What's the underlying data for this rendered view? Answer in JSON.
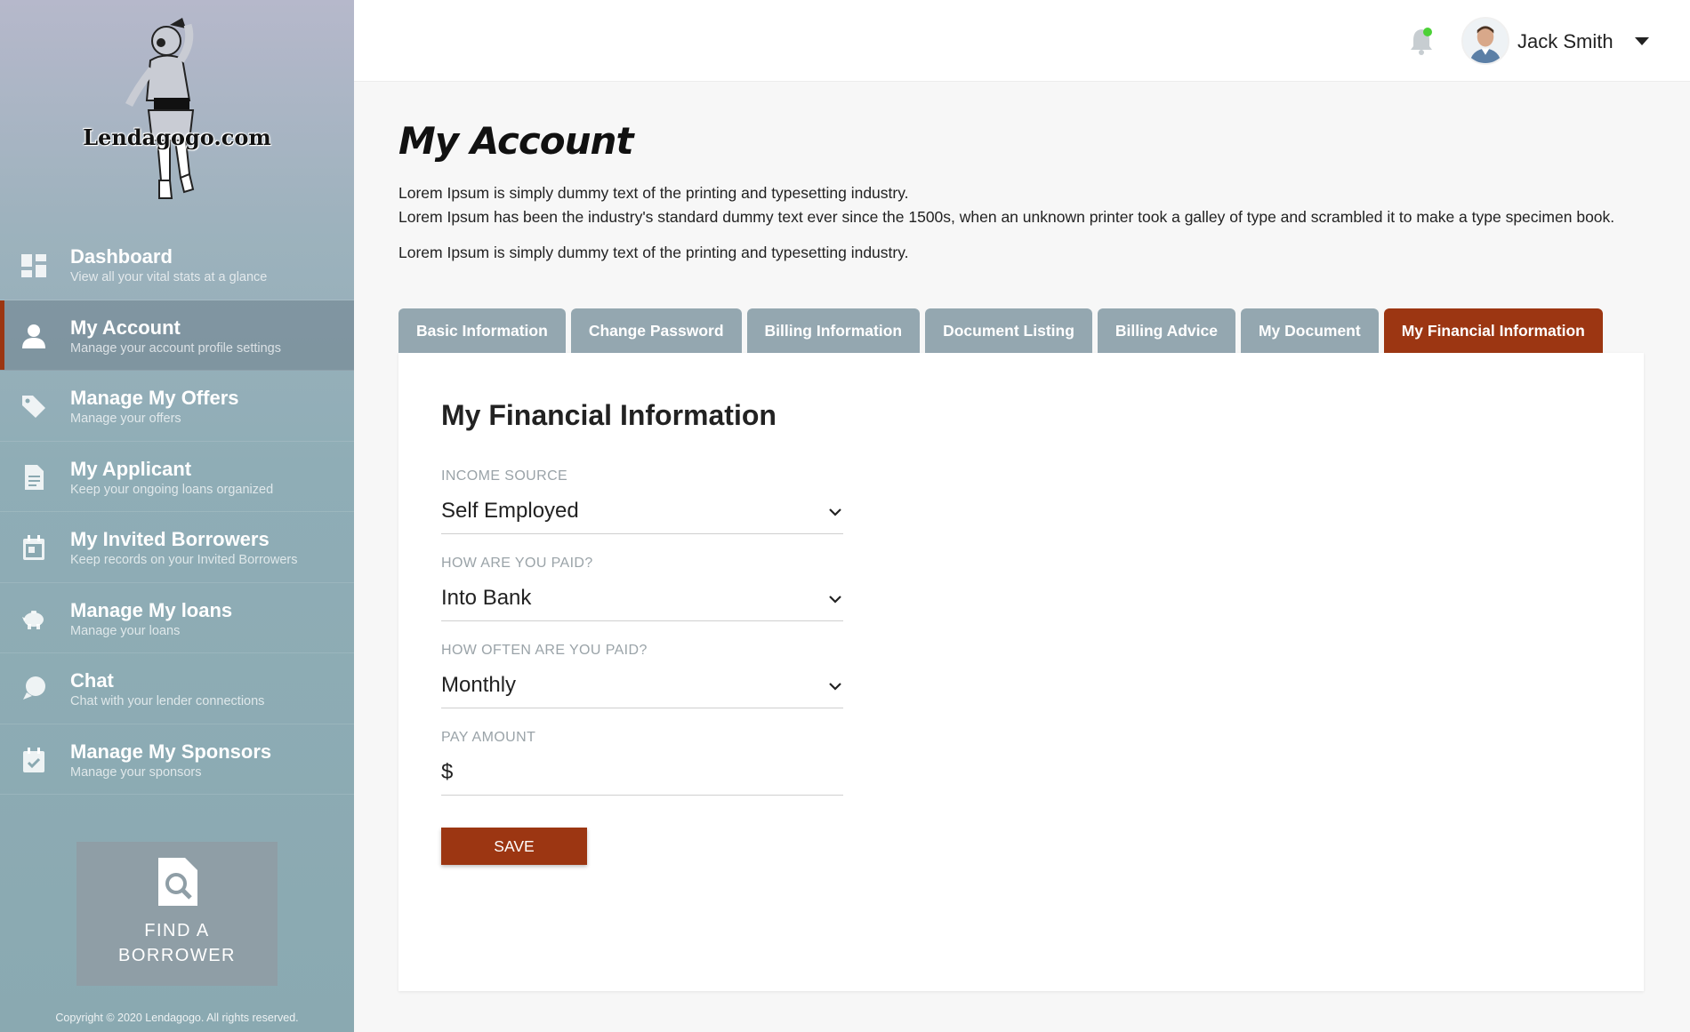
{
  "brand": {
    "logo_text": "Lendagogo.com"
  },
  "sidebar": {
    "items": [
      {
        "title": "Dashboard",
        "subtitle": "View all your vital stats at a glance",
        "icon": "dashboard-icon"
      },
      {
        "title": "My Account",
        "subtitle": "Manage your account profile settings",
        "icon": "user-icon",
        "active": true
      },
      {
        "title": "Manage My Offers",
        "subtitle": "Manage your offers",
        "icon": "tag-icon"
      },
      {
        "title": "My Applicant",
        "subtitle": "Keep your ongoing loans organized",
        "icon": "document-icon"
      },
      {
        "title": "My Invited Borrowers",
        "subtitle": "Keep records on your Invited Borrowers",
        "icon": "calendar-icon"
      },
      {
        "title": "Manage My loans",
        "subtitle": "Manage your loans",
        "icon": "piggy-bank-icon"
      },
      {
        "title": "Chat",
        "subtitle": "Chat with your lender connections",
        "icon": "chat-icon"
      },
      {
        "title": "Manage My Sponsors",
        "subtitle": "Manage  your sponsors",
        "icon": "calendar-check-icon"
      }
    ],
    "find_borrower_label": "FIND A\nBORROWER",
    "copyright": "Copyright © 2020 Lendagogo. All rights reserved."
  },
  "header": {
    "user_name": "Jack Smith",
    "notification_dot_color": "#4cd137"
  },
  "page": {
    "title": "My Account",
    "description_1": "Lorem Ipsum is simply dummy text of the printing and typesetting industry.",
    "description_2": "Lorem Ipsum has been the industry's standard dummy text ever since the 1500s, when an unknown printer took a galley of type and scrambled it to make a type specimen book.",
    "description_3": "Lorem Ipsum is simply dummy text of the printing and typesetting industry."
  },
  "tabs": [
    {
      "label": "Basic Information"
    },
    {
      "label": "Change Password"
    },
    {
      "label": "Billing Information"
    },
    {
      "label": "Document Listing"
    },
    {
      "label": "Billing Advice"
    },
    {
      "label": "My Document"
    },
    {
      "label": "My Financial Information",
      "active": true
    }
  ],
  "form": {
    "title": "My Financial Information",
    "fields": [
      {
        "label": "INCOME SOURCE",
        "value": "Self Employed",
        "type": "select"
      },
      {
        "label": "HOW ARE YOU PAID?",
        "value": "Into Bank",
        "type": "select"
      },
      {
        "label": "HOW OFTEN ARE YOU PAID?",
        "value": "Monthly",
        "type": "select"
      },
      {
        "label": "PAY AMOUNT",
        "value": "$",
        "type": "input"
      }
    ],
    "save_label": "SAVE"
  },
  "colors": {
    "accent": "#9c3612",
    "tab_inactive": "#94a7b0",
    "sidebar_bg": "#8aa9b1"
  }
}
